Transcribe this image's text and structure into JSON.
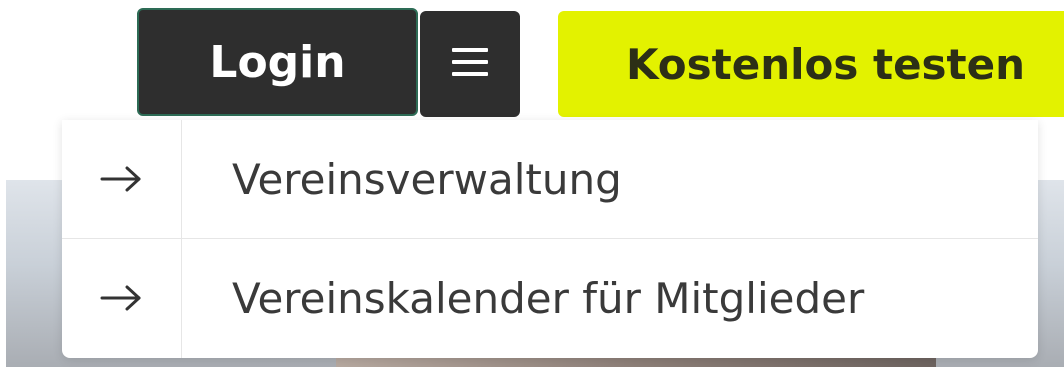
{
  "header": {
    "login_label": "Login",
    "menu_icon": "hamburger-menu-icon",
    "trial_label": "Kostenlos testen"
  },
  "menu": {
    "items": [
      {
        "icon": "arrow-right-icon",
        "label": "Vereinsverwaltung"
      },
      {
        "icon": "arrow-right-icon",
        "label": "Vereinskalender für Mitglieder"
      }
    ]
  },
  "colors": {
    "dark_button": "#2e2e2e",
    "login_border": "#2d6b55",
    "accent": "#e3f200",
    "menu_text": "#3a3a3a"
  }
}
